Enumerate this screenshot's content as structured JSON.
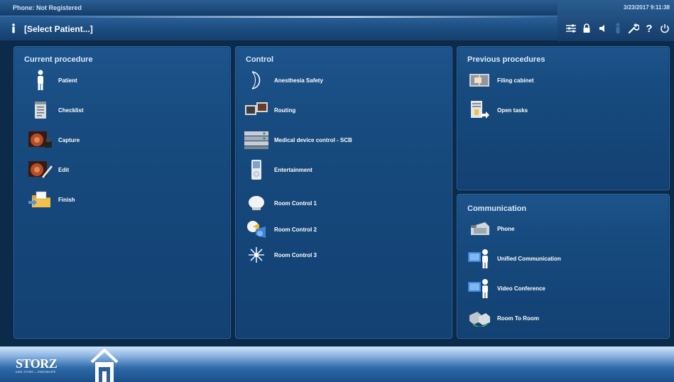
{
  "header": {
    "phone_status": "Phone: Not Registered",
    "datetime": "3/23/2017  9:11:38",
    "select_patient": "[Select Patient...]"
  },
  "toolbar": {
    "icons": [
      "settings-sliders-icon",
      "lock-icon",
      "speaker-icon",
      "person-icon",
      "wrench-icon",
      "help-icon",
      "power-icon"
    ],
    "help_glyph": "?"
  },
  "panels": {
    "current_procedure": {
      "title": "Current procedure",
      "items": [
        {
          "label": "Patient",
          "icon": "patient-icon"
        },
        {
          "label": "Checklist",
          "icon": "checklist-icon"
        },
        {
          "label": "Capture",
          "icon": "capture-icon"
        },
        {
          "label": "Edit",
          "icon": "edit-icon"
        },
        {
          "label": "Finish",
          "icon": "finish-icon"
        }
      ]
    },
    "control": {
      "title": "Control",
      "items": [
        {
          "label": "Anesthesia Safety",
          "icon": "anesthesia-icon"
        },
        {
          "label": "Routing",
          "icon": "routing-icon"
        },
        {
          "label": "Medical device control - SCB",
          "icon": "medical-device-icon"
        },
        {
          "label": "Entertainment",
          "icon": "entertainment-icon"
        },
        {
          "label": "Room Control 1",
          "icon": "room-control-1-icon"
        },
        {
          "label": "Room Control 2",
          "icon": "room-control-2-icon"
        },
        {
          "label": "Room Control 3",
          "icon": "room-control-3-icon"
        }
      ]
    },
    "previous_procedures": {
      "title": "Previous procedures",
      "items": [
        {
          "label": "Filing cabinet",
          "icon": "filing-cabinet-icon"
        },
        {
          "label": "Open tasks",
          "icon": "open-tasks-icon"
        }
      ]
    },
    "communication": {
      "title": "Communication",
      "items": [
        {
          "label": "Phone",
          "icon": "phone-icon"
        },
        {
          "label": "Unified Communication",
          "icon": "unified-communication-icon"
        },
        {
          "label": "Video Conference",
          "icon": "video-conference-icon"
        },
        {
          "label": "Room To Room",
          "icon": "room-to-room-icon"
        }
      ]
    }
  },
  "footer": {
    "brand": "STORZ",
    "brand_tagline": "KARL STORZ — ENDOSKOPE"
  },
  "colors": {
    "background": "#0c2a4a",
    "panel": "#174a7e",
    "panel_border": "#2c6aa6",
    "text": "#ffffff"
  }
}
